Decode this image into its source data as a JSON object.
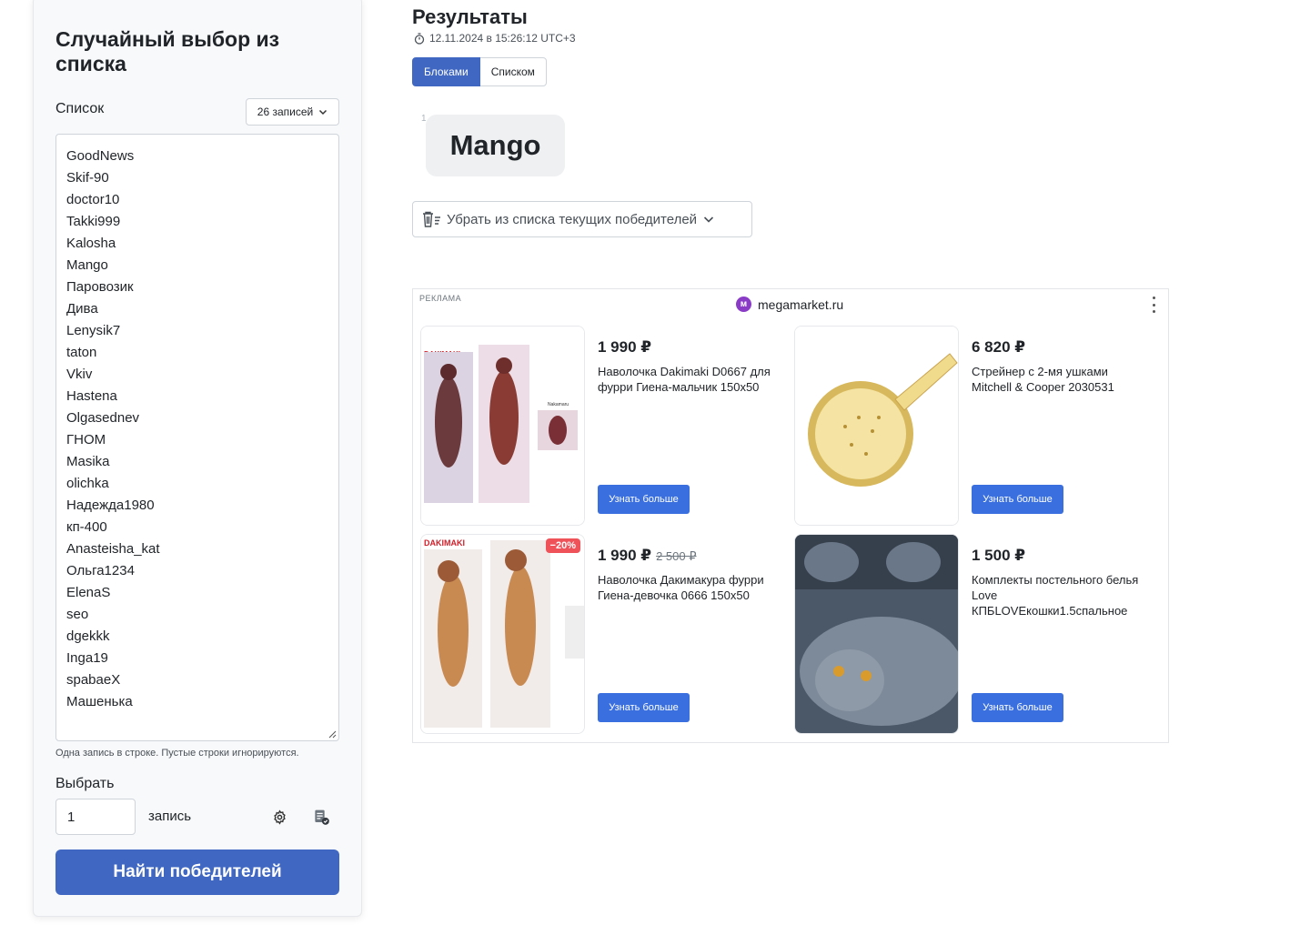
{
  "left_panel": {
    "title": "Случайный выбор из списка",
    "list_label": "Список",
    "count_button": "26 записей",
    "entries": [
      "GoodNews",
      "Skif-90",
      "doctor10",
      "Takki999",
      "Kalosha",
      "Mango",
      "Паровозик",
      "Дива",
      "Lenysik7",
      "taton",
      "Vkiv",
      "Hastena",
      "Olgasednev",
      "ГНОМ",
      "Masika",
      "olichka",
      "Надежда1980",
      "кп-400",
      "Anasteisha_kat",
      "Ольга1234",
      "ElenaS",
      "seo",
      "dgekkk",
      "Inga19",
      "spabaeX",
      "Машенька"
    ],
    "hint": "Одна запись в строке. Пустые строки игнорируются.",
    "choose_label": "Выбрать",
    "choose_value": "1",
    "unit_label": "запись",
    "find_button": "Найти победителей"
  },
  "results": {
    "title": "Результаты",
    "timestamp": "12.11.2024 в 15:26:12 UTC+3",
    "tabs": [
      {
        "label": "Блоками",
        "active": true
      },
      {
        "label": "Списком",
        "active": false
      }
    ],
    "winner_index": "1",
    "winner_name": "Mango",
    "remove_button": "Убрать из списка текущих победителей"
  },
  "ad": {
    "label": "РЕКЛАМА",
    "domain": "megamarket.ru",
    "logo_letter": "м",
    "products": [
      {
        "price": "1 990 ₽",
        "old_price": "",
        "name": "Наволочка Dakimaki D0667 для фурри Гиена-мальчик 150x50",
        "button": "Узнать больше",
        "discount": ""
      },
      {
        "price": "6 820 ₽",
        "old_price": "",
        "name": "Стрейнер с 2-мя ушками Mitchell & Cooper 2030531",
        "button": "Узнать больше",
        "discount": ""
      },
      {
        "price": "1 990 ₽",
        "old_price": "2 500 ₽",
        "name": "Наволочка Дакимакура фурри Гиена-девочка 0666 150x50",
        "button": "Узнать больше",
        "discount": "−20%"
      },
      {
        "price": "1 500 ₽",
        "old_price": "",
        "name": "Комплекты постельного белья Love КПБLOVEкошки1.5спальное",
        "button": "Узнать больше",
        "discount": ""
      }
    ],
    "image_text": {
      "brand": "DAKIMAKI",
      "mini": "Nakamaru"
    }
  },
  "colors": {
    "primary": "#4068c2",
    "ad_button": "#3a6fe0",
    "discount": "#f0525a"
  }
}
